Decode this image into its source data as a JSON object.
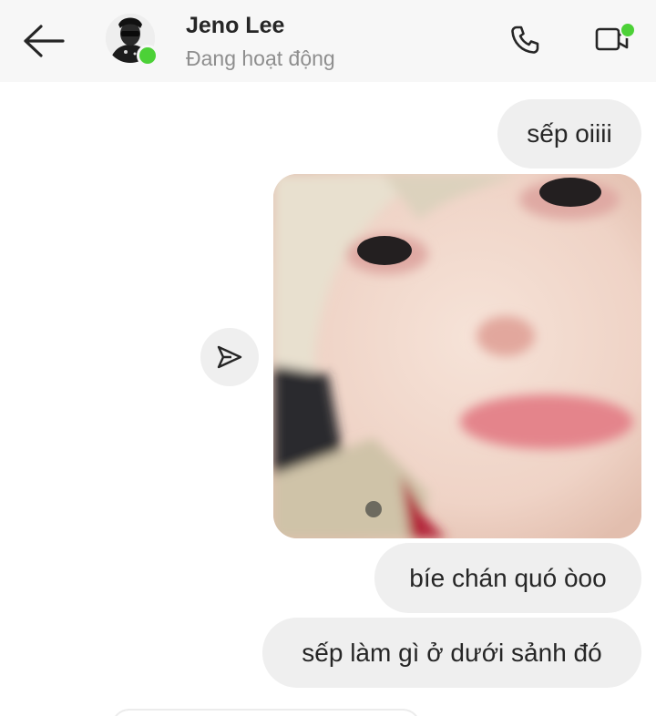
{
  "header": {
    "contact_name": "Jeno Lee",
    "status": "Đang hoạt động",
    "avatar_icon": "profile-photo",
    "back_icon": "arrow-left-icon",
    "call_icon": "phone-icon",
    "video_icon": "video-camera-icon",
    "online_color": "#4cd137"
  },
  "messages": [
    {
      "type": "text",
      "text": "sếp oiiii"
    },
    {
      "type": "image",
      "description_icon": "photo-message"
    },
    {
      "type": "text",
      "text": "bíe chán quó òoo"
    },
    {
      "type": "text",
      "text": "sếp làm gì ở dưới sảnh đó"
    }
  ],
  "share_icon": "paper-plane-icon",
  "colors": {
    "bubble": "#efefef",
    "header_bg": "#f7f7f7",
    "text": "#262626",
    "muted": "#8e8e8e"
  }
}
